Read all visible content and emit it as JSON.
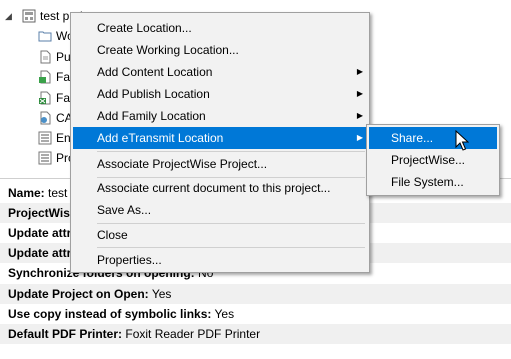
{
  "tree": {
    "root_label": "test project",
    "children": [
      "Wo",
      "Pu",
      "Fa",
      "Fa",
      "CA",
      "En",
      "Pro"
    ]
  },
  "props": [
    {
      "key": "Name:",
      "value": "test"
    },
    {
      "key": "ProjectWise",
      "value": ""
    },
    {
      "key": "Update attr",
      "value": ""
    },
    {
      "key": "Update attr",
      "value": ""
    },
    {
      "key": "Synchronize folders on opening:",
      "value": "No"
    },
    {
      "key": "Update Project on Open:",
      "value": "Yes"
    },
    {
      "key": "Use copy instead of symbolic links:",
      "value": "Yes"
    },
    {
      "key": "Default PDF Printer:",
      "value": "Foxit Reader PDF Printer"
    }
  ],
  "context_menu": {
    "items": [
      {
        "label": "Create Location..."
      },
      {
        "label": "Create Working Location..."
      },
      {
        "label": "Add Content Location"
      },
      {
        "label": "Add Publish Location"
      },
      {
        "label": "Add Family Location"
      },
      {
        "label": "Add eTransmit Location"
      },
      {
        "label": "Associate ProjectWise Project..."
      },
      {
        "label": "Associate current document to this project..."
      },
      {
        "label": "Save As..."
      },
      {
        "label": "Close"
      },
      {
        "label": "Properties..."
      }
    ]
  },
  "submenu": {
    "items": [
      {
        "label": "Share..."
      },
      {
        "label": "ProjectWise..."
      },
      {
        "label": "File System..."
      }
    ]
  },
  "colors": {
    "highlight": "#0078d7",
    "menu_bg": "#f2f2f2",
    "alt_row": "#f0f0f0"
  }
}
